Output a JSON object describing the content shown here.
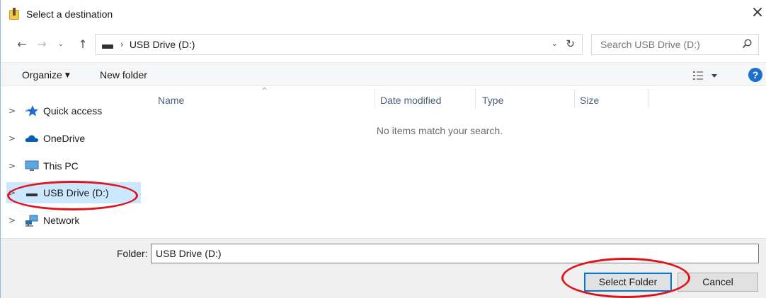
{
  "window": {
    "title": "Select a destination",
    "close_glyph": "×"
  },
  "address_bar": {
    "back_glyph": "←",
    "forward_glyph": "→",
    "recent_glyph": "⌄",
    "up_glyph": "↑",
    "separator": "›",
    "location": "USB Drive (D:)",
    "dropdown_glyph": "⌄",
    "refresh_glyph": "↻"
  },
  "search": {
    "placeholder": "Search USB Drive (D:)",
    "value": ""
  },
  "toolbar": {
    "organize_label": "Organize",
    "new_folder_label": "New folder",
    "help_label": "?"
  },
  "nav": {
    "chevron": ">",
    "items": [
      {
        "label": "Quick access",
        "icon": "star-icon"
      },
      {
        "label": "OneDrive",
        "icon": "cloud-icon"
      },
      {
        "label": "This PC",
        "icon": "monitor-icon"
      },
      {
        "label": "USB Drive (D:)",
        "icon": "drive-icon",
        "selected": true
      },
      {
        "label": "Network",
        "icon": "network-icon"
      }
    ]
  },
  "file_list": {
    "columns": [
      "Name",
      "Date modified",
      "Type",
      "Size"
    ],
    "sort_glyph": "^",
    "empty_message": "No items match your search."
  },
  "footer": {
    "folder_label": "Folder:",
    "folder_value": "USB Drive (D:)",
    "select_button": "Select Folder",
    "cancel_button": "Cancel"
  },
  "colors": {
    "selection": "#cce8ff",
    "accent": "#0078d7",
    "annotation": "#e0141c",
    "star": "#1a6fd1",
    "cloud": "#0a5fb4",
    "help": "#1a6fd1"
  }
}
